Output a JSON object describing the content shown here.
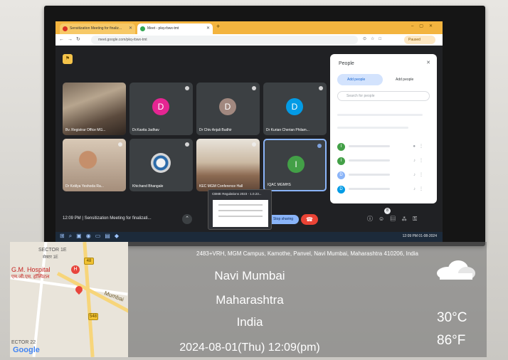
{
  "browser": {
    "tabs": [
      {
        "label": "Sensitization Meeting for finaliz..."
      },
      {
        "label": "Meet - pkq-rbwx-tmt"
      }
    ],
    "url": "meet.google.com/pkq-rbwx-tmt",
    "profile_label": "Paused"
  },
  "meet": {
    "tiles": [
      {
        "name": "Bv. Registrar Office MG..."
      },
      {
        "name": "Dr.Kavita Jadhav",
        "initial": "D",
        "color": "#e52592"
      },
      {
        "name": "Dr Chiv Anjali Budhir",
        "initial": "D",
        "color": "#a1887f"
      },
      {
        "name": "Dr Kurian Cherian Philam...",
        "initial": "D",
        "color": "#039be5"
      },
      {
        "name": "Dr Kstilya Yeshoda Ra..."
      },
      {
        "name": "Khichand Bhangale"
      },
      {
        "name": "KEC MGM Conference Hall"
      },
      {
        "name": "IQAC MGMHS",
        "initial": "I",
        "color": "#43a047"
      }
    ],
    "time_and_title": "12:09 PM | Sensitization Meeting for finalizati...",
    "stop_sharing_label": "Stop sharing",
    "participant_count": "8",
    "people_panel": {
      "title": "People",
      "add_people_label": "Add people",
      "add_people_label2": "Add people",
      "search_placeholder": "Search for people",
      "rows": [
        {
          "initial": "I",
          "color": "#43a047"
        },
        {
          "initial": "I",
          "color": "#43a047"
        },
        {
          "initial": "D",
          "color": "#8ab4f8"
        },
        {
          "initial": "D",
          "color": "#039be5"
        }
      ]
    },
    "share_popup_title": "CBME Regulations 2023 - 1.0.23..."
  },
  "taskbar": {
    "clock": "12:09 PM 01-08-2024"
  },
  "gps_overlay": {
    "map_labels": {
      "sector": "SECTOR 1E",
      "sector_local": "सेक्टर 1E",
      "hospital": "G.M. Hospital",
      "hospital_local": "एम.जी.एम. हॉस्पिटल",
      "road": "Mumbai",
      "route_1": "48",
      "route_2": "548",
      "sector_bottom": "ECTOR 22",
      "google": "Google"
    },
    "address": "2483+VRH, MGM Campus, Kamothe, Panvel, Navi Mumbai, Maharashtra 410206, India",
    "city": "Navi Mumbai",
    "state": "Maharashtra",
    "country": "India",
    "datetime": "2024-08-01(Thu)   12:09(pm)",
    "temp_c": "30°C",
    "temp_f": "86°F",
    "weather_icon": "cloudy-icon"
  }
}
